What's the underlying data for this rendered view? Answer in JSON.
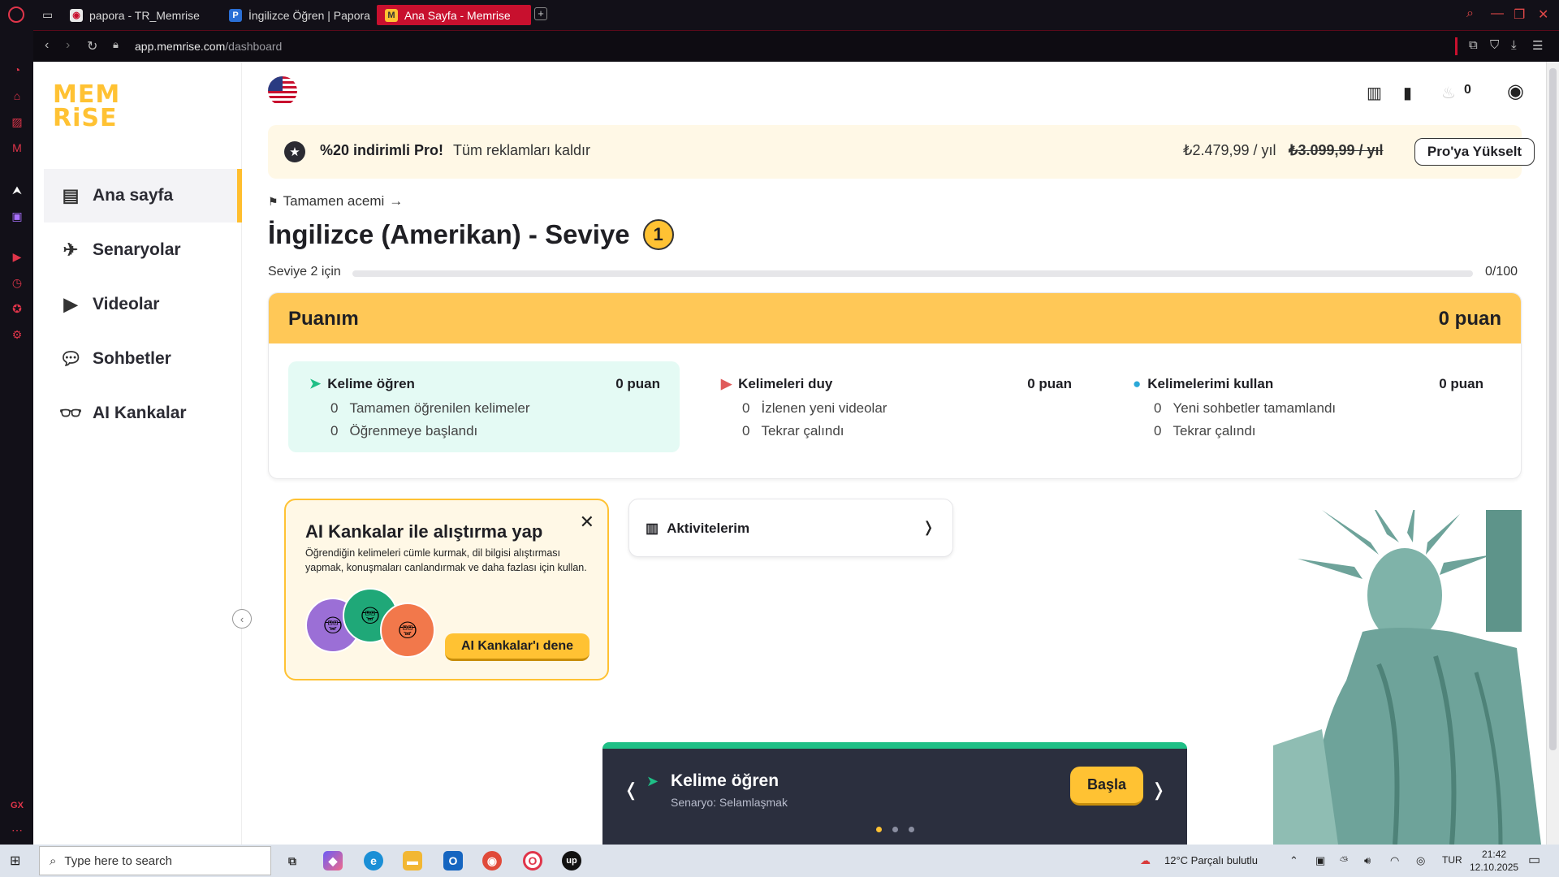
{
  "browser": {
    "tabs": [
      {
        "label": "papora - TR_Memrise",
        "favicon": "git-icon"
      },
      {
        "label": "İngilizce Öğren | Papora",
        "favicon": "P"
      },
      {
        "label": "Ana Sayfa - Memrise",
        "favicon": "memrise-icon"
      }
    ],
    "url_domain": "app.memrise.com",
    "url_path": "/dashboard",
    "accent_color": "#c8102e"
  },
  "logo": {
    "line1": "MEM",
    "line2": "RiSE"
  },
  "nav": {
    "items": [
      {
        "label": "Ana sayfa",
        "icon": "home-icon",
        "active": true
      },
      {
        "label": "Senaryolar",
        "icon": "scenario-icon"
      },
      {
        "label": "Videolar",
        "icon": "video-icon"
      },
      {
        "label": "Sohbetler",
        "icon": "chat-icon"
      },
      {
        "label": "AI Kankalar",
        "icon": "glasses-icon"
      }
    ]
  },
  "header": {
    "streak_count": "0"
  },
  "promo": {
    "title": "%20 indirimli Pro!",
    "subtitle": "Tüm reklamları kaldır",
    "price": "₺2.479,99 / yıl",
    "old_price": "₺3.099,99 / yıl",
    "button": "Pro'ya Yükselt"
  },
  "course": {
    "breadcrumb": "Tamamen acemi",
    "title": "İngilizce (Amerikan) - Seviye",
    "level": "1",
    "progress_label": "Seviye 2 için",
    "progress_count": "0/100",
    "progress_fraction": 0
  },
  "points": {
    "title": "Puanım",
    "total": "0 puan",
    "columns": [
      {
        "title": "Kelime öğren",
        "points": "0 puan",
        "rows": [
          {
            "n": "0",
            "t": "Tamamen öğrenilen kelimeler"
          },
          {
            "n": "0",
            "t": "Öğrenmeye başlandı"
          }
        ]
      },
      {
        "title": "Kelimeleri duy",
        "points": "0 puan",
        "rows": [
          {
            "n": "0",
            "t": "İzlenen yeni videolar"
          },
          {
            "n": "0",
            "t": "Tekrar çalındı"
          }
        ]
      },
      {
        "title": "Kelimelerimi kullan",
        "points": "0 puan",
        "rows": [
          {
            "n": "0",
            "t": "Yeni sohbetler tamamlandı"
          },
          {
            "n": "0",
            "t": "Tekrar çalındı"
          }
        ]
      }
    ]
  },
  "ai_card": {
    "title": "AI Kankalar ile alıştırma yap",
    "description": "Öğrendiğin kelimeleri cümle kurmak, dil bilgisi alıştırması yapmak, konuşmaları canlandırmak ve daha fazlası için kullan.",
    "button": "AI Kankalar'ı dene"
  },
  "activity": {
    "label": "Aktivitelerim",
    "chevron": "❭"
  },
  "carousel": {
    "title": "Kelime öğren",
    "subtitle": "Senaryo: Selamlaşmak",
    "button": "Başla",
    "prev": "❬",
    "next": "❭"
  },
  "taskbar": {
    "search_placeholder": "Type here to search",
    "weather": "12°C  Parçalı bulutlu",
    "lang": "TUR",
    "time": "21:42",
    "date": "12.10.2025"
  }
}
